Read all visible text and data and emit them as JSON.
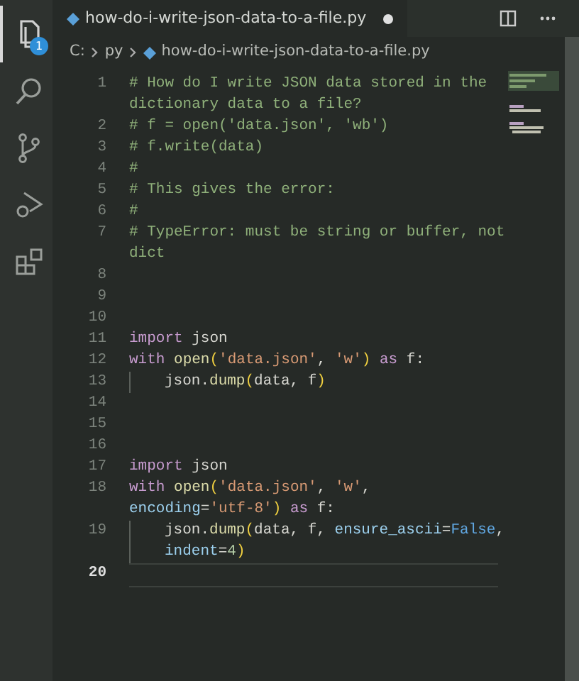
{
  "activity_bar": [
    {
      "kind": "explorer",
      "badge": "1",
      "selected": true
    },
    {
      "kind": "search",
      "selected": false
    },
    {
      "kind": "source-control",
      "selected": false
    },
    {
      "kind": "run-debug",
      "selected": false
    },
    {
      "kind": "extensions",
      "selected": false
    }
  ],
  "tab": {
    "label": "how-do-i-write-json-data-to-a-file.py",
    "modified": true,
    "selected": true
  },
  "breadcrumb": [
    "C:",
    "py",
    "how-do-i-write-json-data-to-a-file.py"
  ],
  "editor": {
    "lines": [
      {
        "number": "1",
        "current": false,
        "rows": [
          {
            "tokens": [
              {
                "kind": "comment",
                "text": "# How do I write JSON data stored in the"
              }
            ]
          },
          {
            "tokens": [
              {
                "kind": "comment",
                "text": "dictionary data to a file?"
              }
            ]
          }
        ]
      },
      {
        "number": "2",
        "current": false,
        "rows": [
          {
            "tokens": [
              {
                "kind": "comment",
                "text": "# f = open('data.json', 'wb')"
              }
            ]
          }
        ]
      },
      {
        "number": "3",
        "current": false,
        "rows": [
          {
            "tokens": [
              {
                "kind": "comment",
                "text": "# f.write(data)"
              }
            ]
          }
        ]
      },
      {
        "number": "4",
        "current": false,
        "rows": [
          {
            "tokens": [
              {
                "kind": "comment",
                "text": "#"
              }
            ]
          }
        ]
      },
      {
        "number": "5",
        "current": false,
        "rows": [
          {
            "tokens": [
              {
                "kind": "comment",
                "text": "# This gives the error:"
              }
            ]
          }
        ]
      },
      {
        "number": "6",
        "current": false,
        "rows": [
          {
            "tokens": [
              {
                "kind": "comment",
                "text": "#"
              }
            ]
          }
        ]
      },
      {
        "number": "7",
        "current": false,
        "rows": [
          {
            "tokens": [
              {
                "kind": "comment",
                "text": "# TypeError: must be string or buffer, not"
              }
            ]
          },
          {
            "tokens": [
              {
                "kind": "comment",
                "text": "dict"
              }
            ]
          }
        ]
      },
      {
        "number": "8",
        "current": false
      },
      {
        "number": "9",
        "current": false
      },
      {
        "number": "10",
        "current": false
      },
      {
        "number": "11",
        "current": false,
        "rows": [
          {
            "tokens": [
              {
                "kind": "keyword",
                "text": "import"
              },
              {
                "kind": "plain",
                "text": " json"
              }
            ]
          }
        ]
      },
      {
        "number": "12",
        "current": false,
        "rows": [
          {
            "tokens": [
              {
                "kind": "keyword",
                "text": "with"
              },
              {
                "kind": "function",
                "text": " open"
              },
              {
                "kind": "bracket",
                "text": "("
              },
              {
                "kind": "string",
                "text": "'data.json'"
              },
              {
                "kind": "plain",
                "text": ", "
              },
              {
                "kind": "string",
                "text": "'w'"
              },
              {
                "kind": "bracket",
                "text": ")"
              },
              {
                "kind": "keyword",
                "text": " as"
              },
              {
                "kind": "plain",
                "text": " f:"
              }
            ]
          }
        ]
      },
      {
        "number": "13",
        "current": false,
        "indent": true,
        "rows": [
          {
            "tokens": [
              {
                "kind": "plain",
                "text": "json."
              },
              {
                "kind": "function",
                "text": "dump"
              },
              {
                "kind": "bracket",
                "text": "("
              },
              {
                "kind": "plain",
                "text": "data, f"
              },
              {
                "kind": "bracket",
                "text": ")"
              }
            ]
          }
        ]
      },
      {
        "number": "14",
        "current": false
      },
      {
        "number": "15",
        "current": false
      },
      {
        "number": "16",
        "current": false
      },
      {
        "number": "17",
        "current": false,
        "rows": [
          {
            "tokens": [
              {
                "kind": "keyword",
                "text": "import"
              },
              {
                "kind": "plain",
                "text": " json"
              }
            ]
          }
        ]
      },
      {
        "number": "18",
        "current": false,
        "rows": [
          {
            "tokens": [
              {
                "kind": "keyword",
                "text": "with"
              },
              {
                "kind": "function",
                "text": " open"
              },
              {
                "kind": "bracket",
                "text": "("
              },
              {
                "kind": "string",
                "text": "'data.json'"
              },
              {
                "kind": "plain",
                "text": ", "
              },
              {
                "kind": "string",
                "text": "'w'"
              },
              {
                "kind": "plain",
                "text": ","
              }
            ]
          },
          {
            "tokens": [
              {
                "kind": "param",
                "text": "encoding"
              },
              {
                "kind": "plain",
                "text": "="
              },
              {
                "kind": "string",
                "text": "'utf-8'"
              },
              {
                "kind": "bracket",
                "text": ")"
              },
              {
                "kind": "keyword",
                "text": " as"
              },
              {
                "kind": "plain",
                "text": " f:"
              }
            ]
          }
        ]
      },
      {
        "number": "19",
        "current": false,
        "indent": true,
        "rows": [
          {
            "tokens": [
              {
                "kind": "plain",
                "text": "json."
              },
              {
                "kind": "function",
                "text": "dump"
              },
              {
                "kind": "bracket",
                "text": "("
              },
              {
                "kind": "plain",
                "text": "data, f, "
              },
              {
                "kind": "param",
                "text": "ensure_ascii"
              },
              {
                "kind": "plain",
                "text": "="
              },
              {
                "kind": "constant",
                "text": "False"
              },
              {
                "kind": "plain",
                "text": ","
              }
            ]
          },
          {
            "tokens": [
              {
                "kind": "param",
                "text": "indent"
              },
              {
                "kind": "plain",
                "text": "="
              },
              {
                "kind": "number",
                "text": "4"
              },
              {
                "kind": "bracket",
                "text": ")"
              }
            ]
          }
        ]
      },
      {
        "number": "20",
        "current": true
      }
    ]
  }
}
